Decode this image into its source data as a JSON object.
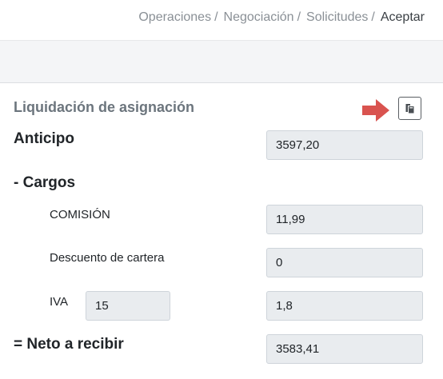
{
  "breadcrumb": {
    "items": [
      "Operaciones",
      "Negociación",
      "Solicitudes"
    ],
    "separator": "/",
    "current": "Aceptar"
  },
  "section": {
    "title": "Liquidación de asignación",
    "copy_icon": "copy-icon",
    "arrow_icon": "arrow-right-icon",
    "arrow_color": "#d9534f"
  },
  "anticipo": {
    "label": "Anticipo",
    "value": "3597,20"
  },
  "cargos": {
    "label": "- Cargos",
    "comision": {
      "label": "COMISIÓN",
      "value": "11,99"
    },
    "descuento": {
      "label": "Descuento de cartera",
      "value": "0"
    },
    "iva": {
      "label": "IVA",
      "rate": "15",
      "value": "1,8"
    }
  },
  "neto": {
    "label": "= Neto a recibir",
    "value": "3583,41"
  }
}
